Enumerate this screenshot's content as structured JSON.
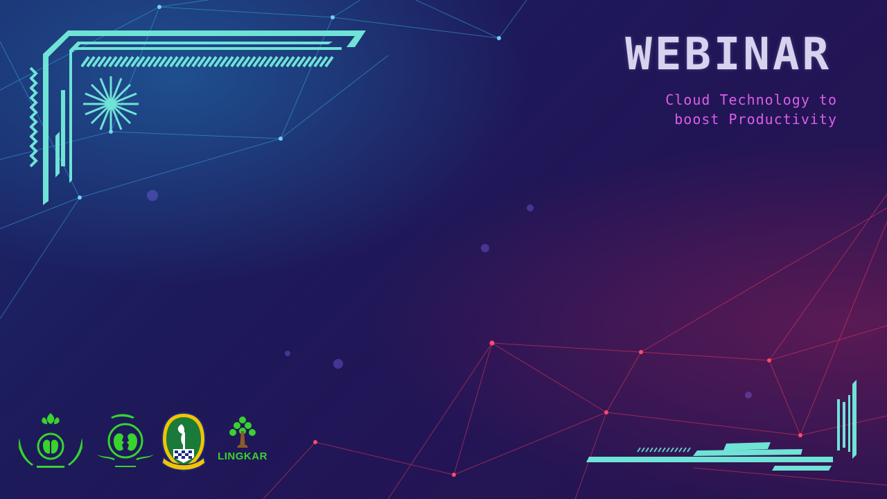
{
  "slide": {
    "title": "WEBINAR",
    "subtitle_line1": "Cloud Technology to",
    "subtitle_line2": "boost Productivity"
  },
  "logos": [
    {
      "icon": "green-initiative-laurel-logo"
    },
    {
      "icon": "green-initiative-faces-logo"
    },
    {
      "icon": "west-java-province-emblem"
    },
    {
      "icon": "lingkar-tree-logo",
      "text": "LINGKAR"
    }
  ],
  "colors": {
    "title": "#d7d3ef",
    "subtitle": "#d95fe6",
    "frame": "#6fe3d6",
    "network_blue": "#3ab0ff",
    "network_red": "#ff3a5a",
    "logo_green": "#39d22e"
  }
}
